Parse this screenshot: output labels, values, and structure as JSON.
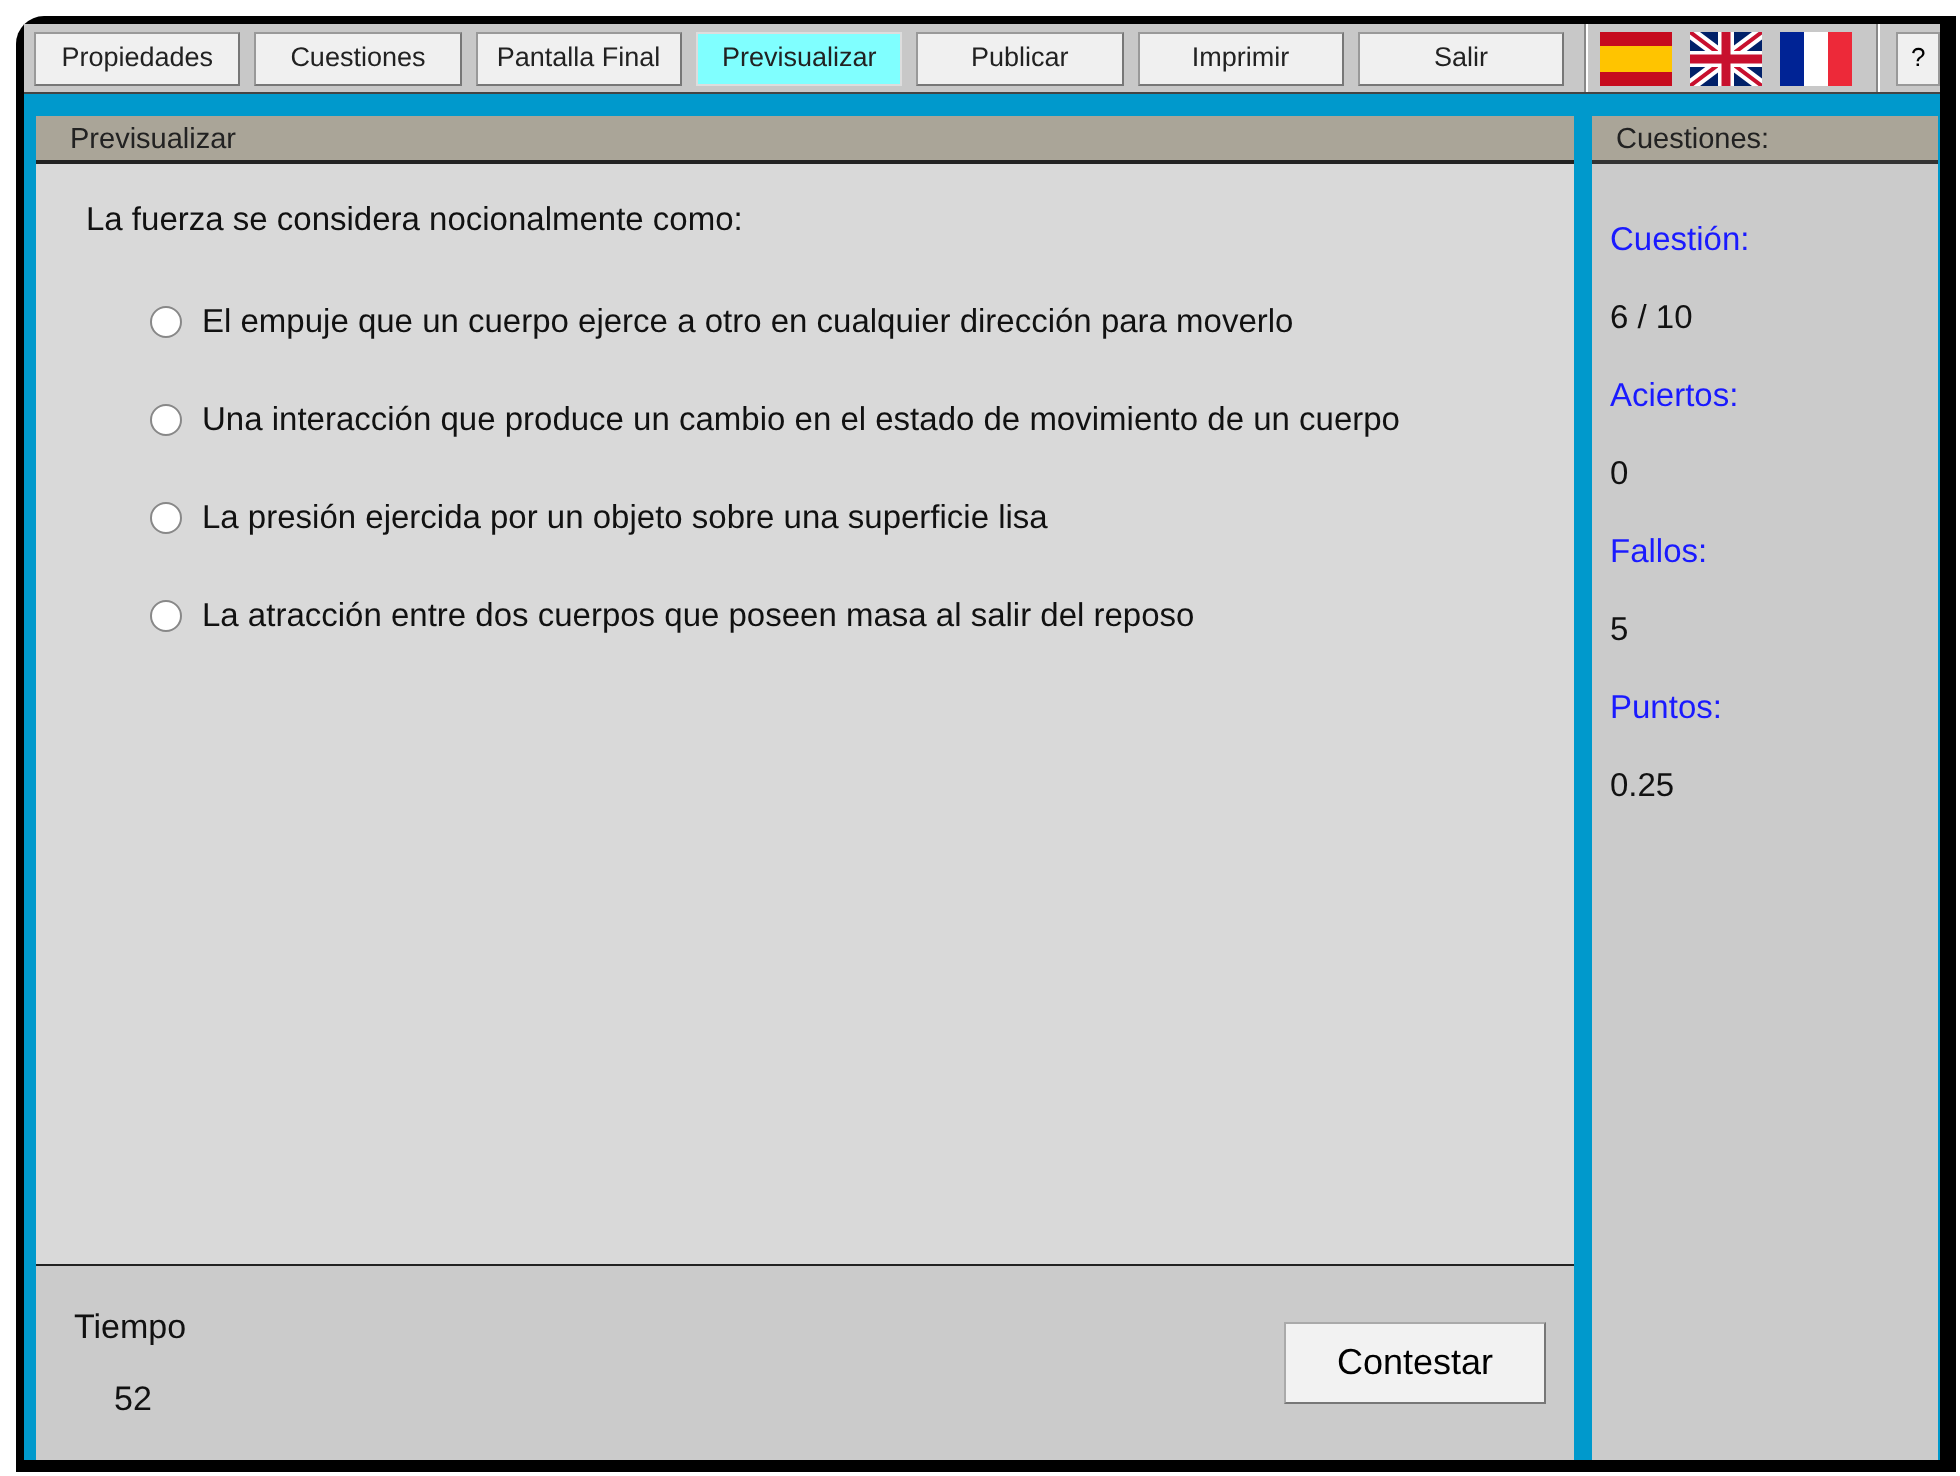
{
  "toolbar": {
    "tabs": [
      {
        "label": "Propiedades",
        "selected": false
      },
      {
        "label": "Cuestiones",
        "selected": false
      },
      {
        "label": "Pantalla Final",
        "selected": false
      },
      {
        "label": "Previsualizar",
        "selected": true
      },
      {
        "label": "Publicar",
        "selected": false
      },
      {
        "label": "Imprimir",
        "selected": false
      },
      {
        "label": "Salir",
        "selected": false
      }
    ],
    "languages": [
      {
        "kind": "es"
      },
      {
        "kind": "uk"
      },
      {
        "kind": "fr"
      }
    ],
    "help": "?"
  },
  "preview": {
    "title": "Previsualizar",
    "question": "La fuerza se considera nocionalmente como:",
    "options": [
      {
        "label": "El empuje que un cuerpo ejerce a otro en cualquier dirección para moverlo",
        "checked": false
      },
      {
        "label": "Una interacción que produce un cambio en el estado de movimiento de un cuerpo",
        "checked": false
      },
      {
        "label": "La presión ejercida por un objeto sobre una superficie lisa",
        "checked": false
      },
      {
        "label": "La atracción entre dos cuerpos que poseen masa al salir del reposo",
        "checked": false
      }
    ],
    "timer_label": "Tiempo",
    "timer_value": "52",
    "submit_button": "Contestar"
  },
  "stats": {
    "title": "Cuestiones:",
    "items": [
      {
        "label": "Cuestión:",
        "value": "6 / 10"
      },
      {
        "label": "Aciertos:",
        "value": "0"
      },
      {
        "label": "Fallos:",
        "value": "5"
      },
      {
        "label": "Puntos:",
        "value": "0.25"
      }
    ]
  }
}
